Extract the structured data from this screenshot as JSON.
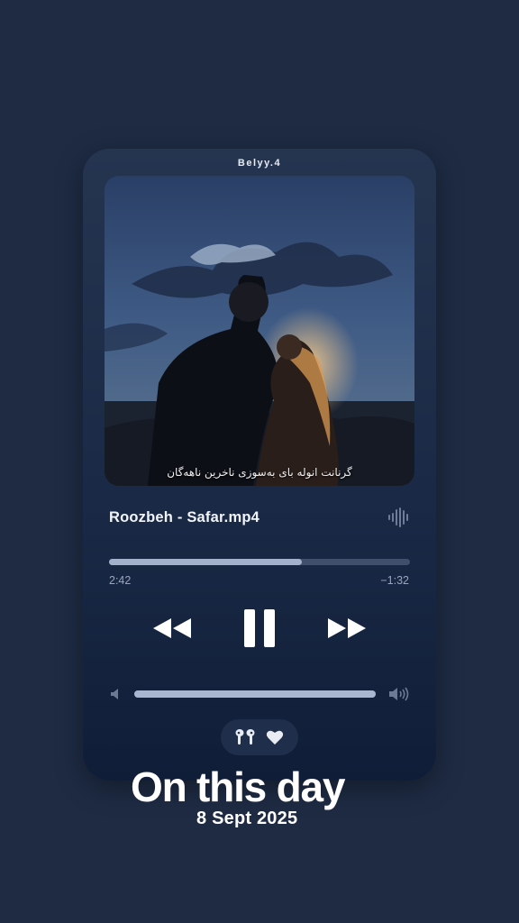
{
  "player": {
    "device_name": "Belyy.4",
    "artwork_caption": "گرنانت انوله بای بەسوزی ناخرین ناهەگان",
    "track_title": "Roozbeh - Safar.mp4",
    "elapsed": "2:42",
    "remaining": "−1:32",
    "progress_fraction": 0.64,
    "volume_fraction": 1.0,
    "controls": {
      "rewind": "backward-icon",
      "play_pause": "pause-icon",
      "forward": "forward-icon",
      "waveform": "waveform-icon",
      "output": "airpods-icon",
      "favorite": "heart-icon"
    }
  },
  "overlay": {
    "headline": "On this day",
    "date": "8 Sept 2025"
  },
  "colors": {
    "background": "#1e2b43",
    "card": "#1a2a46",
    "progress_fill": "#a4b1cc",
    "text": "#ffffff"
  }
}
